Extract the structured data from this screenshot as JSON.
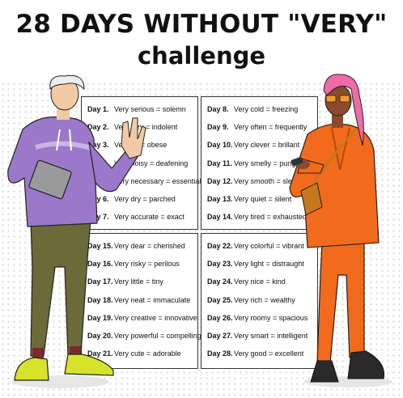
{
  "title": "28 DAYS WITHOUT \"VERY\"",
  "subtitle": "challenge",
  "panels": [
    [
      {
        "day": "Day 1.",
        "text": "Very serious = solemn"
      },
      {
        "day": "Day 2.",
        "text": "Very lazy = indolent"
      },
      {
        "day": "Day 3.",
        "text": "Very fat = obese"
      },
      {
        "day": "Day 4.",
        "text": "Very noisy = deafening"
      },
      {
        "day": "Day 5.",
        "text": "Very necessary = essential"
      },
      {
        "day": "Day 6.",
        "text": "Very dry = parched"
      },
      {
        "day": "Day 7.",
        "text": "Very accurate = exact"
      }
    ],
    [
      {
        "day": "Day 8.",
        "text": "Very cold = freezing"
      },
      {
        "day": "Day 9.",
        "text": "Very often = frequently"
      },
      {
        "day": "Day 10.",
        "text": "Very clever = brillant"
      },
      {
        "day": "Day 11.",
        "text": "Very smelly = pungent"
      },
      {
        "day": "Day 12.",
        "text": "Very smooth = sleek"
      },
      {
        "day": "Day 13.",
        "text": "Very quiet = silent"
      },
      {
        "day": "Day 14.",
        "text": "Very tired = exhausted"
      }
    ],
    [
      {
        "day": "Day 15.",
        "text": "Very dear = cherished"
      },
      {
        "day": "Day 16.",
        "text": "Very risky = perilous"
      },
      {
        "day": "Day 17.",
        "text": "Very little = tiny"
      },
      {
        "day": "Day 18.",
        "text": "Very neat = immaculate"
      },
      {
        "day": "Day 19.",
        "text": "Very creative = innovative"
      },
      {
        "day": "Day 20.",
        "text": "Very powerful = compelling"
      },
      {
        "day": "Day 21.",
        "text": "Very cute = adorable"
      }
    ],
    [
      {
        "day": "Day 22.",
        "text": "Very colorful = vibrant"
      },
      {
        "day": "Day 23.",
        "text": "Very light = distraught"
      },
      {
        "day": "Day 24.",
        "text": "Very nice = kind"
      },
      {
        "day": "Day 25.",
        "text": "Very rich = wealthy"
      },
      {
        "day": "Day 26.",
        "text": "Very roomy = spacious"
      },
      {
        "day": "Day 27.",
        "text": "Very smart = intelligent"
      },
      {
        "day": "Day 28.",
        "text": "Very good = excellent"
      }
    ]
  ],
  "colors": {
    "hoodie": "#9b78c9",
    "pants_man": "#6b6b3a",
    "shoes_man": "#d6e32a",
    "suit_woman": "#f26a1b",
    "hair_woman": "#f06aa8",
    "skin_woman": "#8a4a2e",
    "skin_man": "#f2c9a5"
  }
}
